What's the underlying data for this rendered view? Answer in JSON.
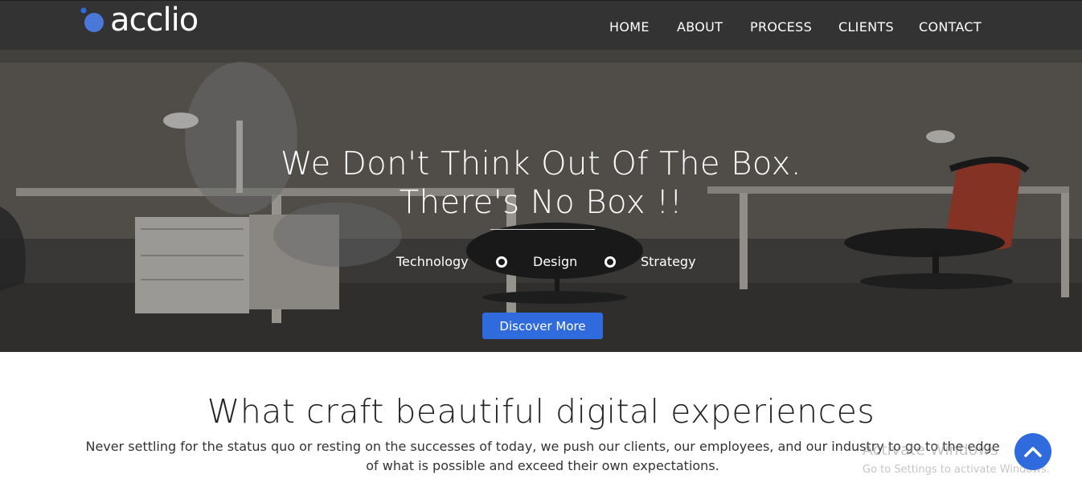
{
  "brand": {
    "name": "acclio",
    "icon": "logo-dots-icon",
    "accent": "#2f6bdc"
  },
  "nav": {
    "items": [
      {
        "label": "HOME"
      },
      {
        "label": "ABOUT"
      },
      {
        "label": "PROCESS"
      },
      {
        "label": "CLIENTS"
      },
      {
        "label": "CONTACT"
      }
    ]
  },
  "hero": {
    "title_line1": "We Don't Think Out Of The Box.",
    "title_line2": "There's No Box !!",
    "tags": [
      "Technology",
      "Design",
      "Strategy"
    ],
    "button_label": "Discover More"
  },
  "section": {
    "title": "What craft beautiful digital experiences",
    "text": "Never settling for the status quo or resting on the successes of today, we push our clients, our employees, and our industry to go to the edge of what is possible and exceed their own expectations."
  },
  "watermark": {
    "title": "Activate Windows",
    "subtitle": "Go to Settings to activate Windows."
  },
  "scroll_top": {
    "icon": "chevron-up-icon"
  }
}
